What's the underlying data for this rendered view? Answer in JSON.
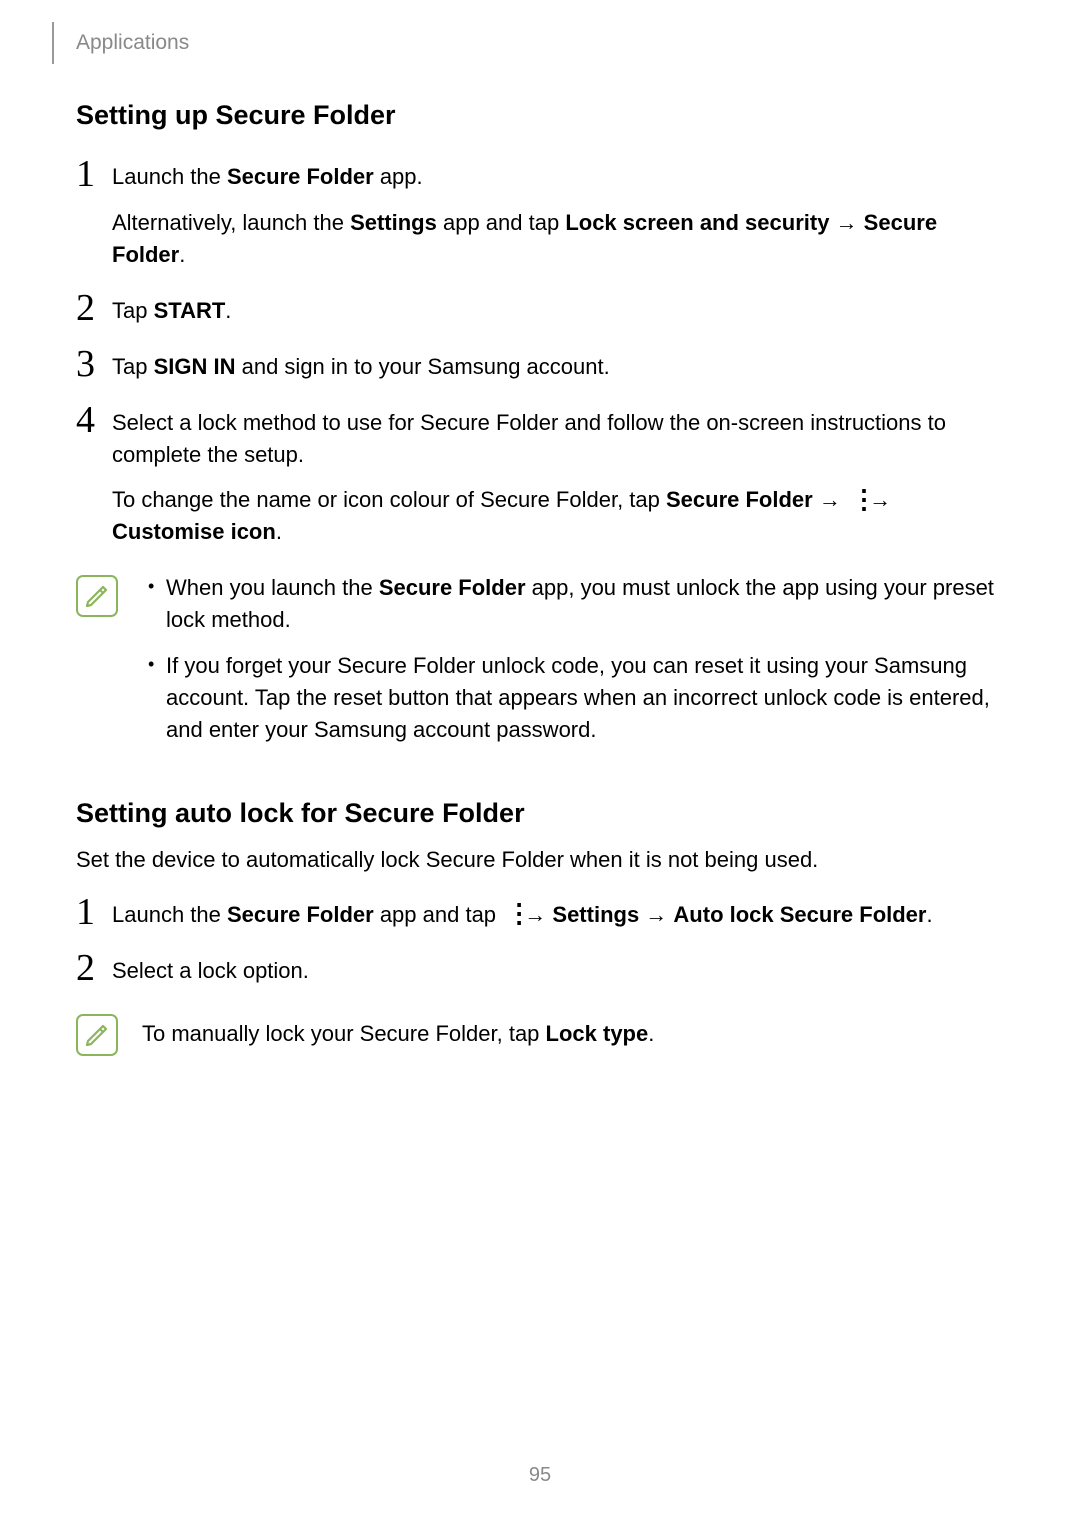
{
  "header": {
    "section": "Applications"
  },
  "page_number": "95",
  "section1": {
    "heading": "Setting up Secure Folder",
    "steps": {
      "s1": {
        "num": "1",
        "p1_a": "Launch the ",
        "p1_b": "Secure Folder",
        "p1_c": " app.",
        "p2_a": "Alternatively, launch the ",
        "p2_b": "Settings",
        "p2_c": " app and tap ",
        "p2_d": "Lock screen and security",
        "p2_e": " → ",
        "p2_f": "Secure Folder",
        "p2_g": "."
      },
      "s2": {
        "num": "2",
        "p1_a": "Tap ",
        "p1_b": "START",
        "p1_c": "."
      },
      "s3": {
        "num": "3",
        "p1_a": "Tap ",
        "p1_b": "SIGN IN",
        "p1_c": " and sign in to your Samsung account."
      },
      "s4": {
        "num": "4",
        "p1": "Select a lock method to use for Secure Folder and follow the on-screen instructions to complete the setup.",
        "p2_a": "To change the name or icon colour of Secure Folder, tap ",
        "p2_b": "Secure Folder",
        "p2_c": " → ",
        "p2_d": " → ",
        "p2_e": "Customise icon",
        "p2_f": "."
      }
    },
    "note": {
      "b1_a": "When you launch the ",
      "b1_b": "Secure Folder",
      "b1_c": " app, you must unlock the app using your preset lock method.",
      "b2": "If you forget your Secure Folder unlock code, you can reset it using your Samsung account. Tap the reset button that appears when an incorrect unlock code is entered, and enter your Samsung account password."
    }
  },
  "section2": {
    "heading": "Setting auto lock for Secure Folder",
    "intro": "Set the device to automatically lock Secure Folder when it is not being used.",
    "steps": {
      "s1": {
        "num": "1",
        "p1_a": "Launch the ",
        "p1_b": "Secure Folder",
        "p1_c": " app and tap ",
        "p1_d": " → ",
        "p1_e": "Settings",
        "p1_f": " → ",
        "p1_g": "Auto lock Secure Folder",
        "p1_h": "."
      },
      "s2": {
        "num": "2",
        "p1": "Select a lock option."
      }
    },
    "note": {
      "p1_a": "To manually lock your Secure Folder, tap ",
      "p1_b": "Lock type",
      "p1_c": "."
    }
  }
}
